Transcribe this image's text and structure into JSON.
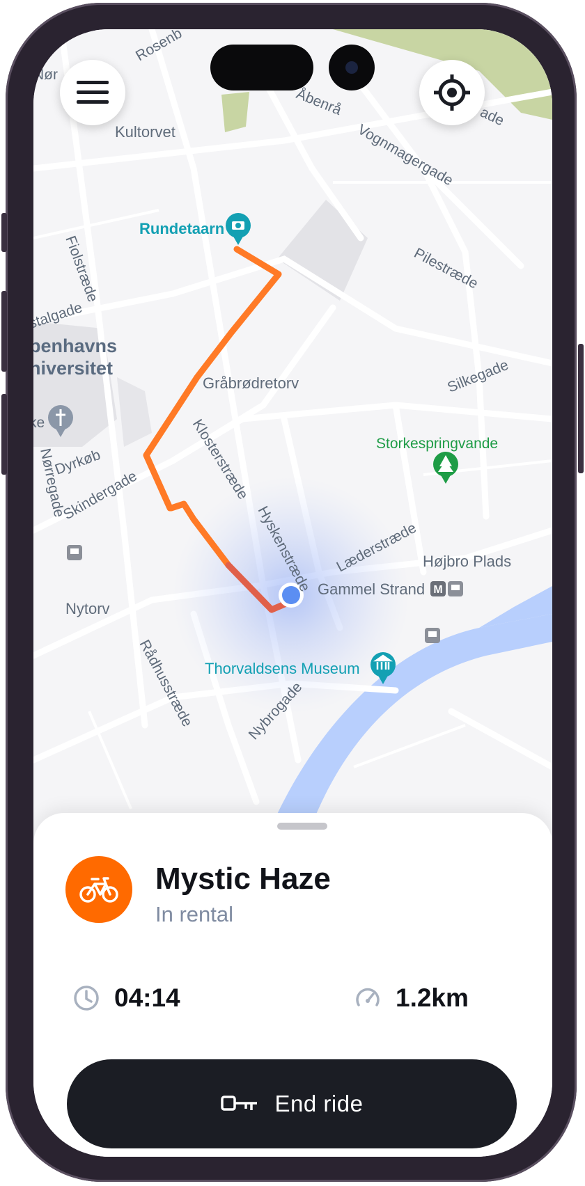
{
  "map": {
    "labels": {
      "norre": "Nør",
      "rosenb": "Rosenb",
      "kultorvet": "Kultorvet",
      "abenra": "Åbenrå",
      "vognmagergade": "Vognmagergade",
      "ade": "ade",
      "rundetaarn": "Rundetaarn",
      "fiolstraede": "Fiolstræde",
      "pilestraede": "Pilestræde",
      "stalgade": "stalgade",
      "univ_line1": "benhavns",
      "univ_line2": "niversitet",
      "grabrodretorv": "Gråbrødretorv",
      "silkegade": "Silkegade",
      "ke": "ke",
      "storkespringvandet": "Storkespringvande",
      "norregade": "Nørregade",
      "dyrkob": "Dyrkøb",
      "klosterstraede": "Klosterstræde",
      "skindergade": "Skindergade",
      "hyskenstraede": "Hyskenstræde",
      "laederstraede": "Læderstræde",
      "hojbro_plads": "Højbro Plads",
      "gammel_strand": "Gammel Strand",
      "metro_badge": "M",
      "nytorv": "Nytorv",
      "radhusstraede": "Rådhusstræde",
      "thorvaldsens_museum": "Thorvaldsens Museum",
      "nybrogade": "Nybrogade"
    },
    "colors": {
      "route_orange": "#ff7a26",
      "route_red": "#e0604a",
      "water": "#b8cffd",
      "park": "#c8d5a3",
      "teal_poi": "#13a0b3",
      "green_poi": "#1e9c46",
      "location_dot": "#5b8ef2"
    }
  },
  "controls": {
    "menu_icon": "hamburger-menu-icon",
    "locate_icon": "crosshair-locate-icon"
  },
  "ride": {
    "bike_name": "Mystic Haze",
    "status": "In rental",
    "duration": "04:14",
    "distance": "1.2km",
    "end_button_label": "End ride",
    "accent": "#ff6a00",
    "button_color": "#1b1d24"
  }
}
